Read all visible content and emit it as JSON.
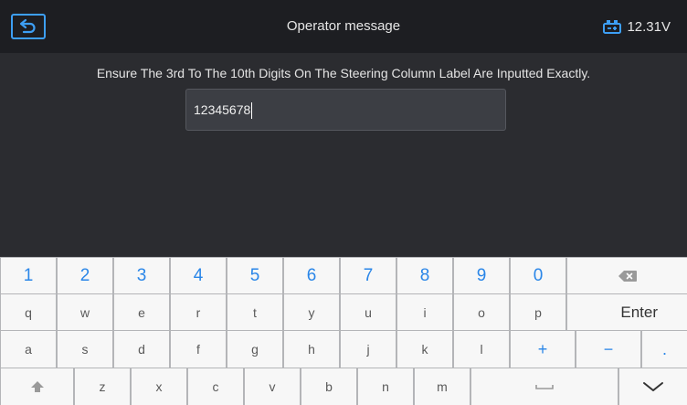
{
  "header": {
    "title": "Operator message",
    "voltage": "12.31V",
    "back_icon": "back-arrow-icon",
    "battery_icon": "battery-vehicle-icon"
  },
  "message": {
    "text": "Ensure The 3rd To The 10th Digits On The Steering Column Label Are Inputted Exactly."
  },
  "input": {
    "value": "12345678"
  },
  "keyboard": {
    "row1": [
      "1",
      "2",
      "3",
      "4",
      "5",
      "6",
      "7",
      "8",
      "9",
      "0"
    ],
    "row2": [
      "q",
      "w",
      "e",
      "r",
      "t",
      "y",
      "u",
      "i",
      "o",
      "p"
    ],
    "row3": [
      "a",
      "s",
      "d",
      "f",
      "g",
      "h",
      "j",
      "k",
      "l",
      "+",
      "−",
      "."
    ],
    "row4": [
      "z",
      "x",
      "c",
      "v",
      "b",
      "n",
      "m"
    ],
    "enter_label": "Enter",
    "icons": {
      "backspace": "backspace-icon",
      "shift": "shift-icon",
      "space": "space-icon",
      "hide": "chevron-down-icon"
    },
    "colors": {
      "accent": "#2a86e8",
      "background": "#b4b5b8",
      "key": "#f7f7f7"
    }
  }
}
